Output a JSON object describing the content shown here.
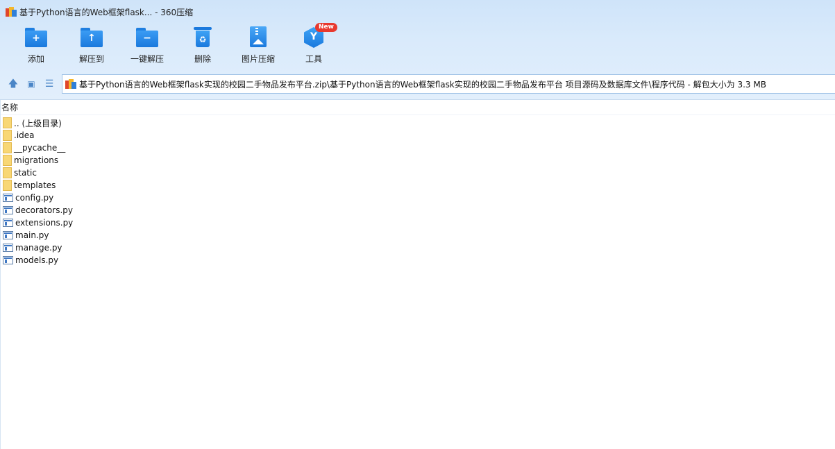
{
  "window": {
    "title": "基于Python语言的Web框架flask... - 360压缩"
  },
  "toolbar": {
    "items": [
      {
        "label": "添加",
        "icon": "add-folder-icon"
      },
      {
        "label": "解压到",
        "icon": "extract-to-icon"
      },
      {
        "label": "一键解压",
        "icon": "one-click-extract-icon"
      },
      {
        "label": "删除",
        "icon": "delete-icon"
      },
      {
        "label": "图片压缩",
        "icon": "image-compress-icon"
      },
      {
        "label": "工具",
        "icon": "tools-icon"
      }
    ],
    "new_badge": "New"
  },
  "navbar": {
    "path": "基于Python语言的Web框架flask实现的校园二手物品发布平台.zip\\基于Python语言的Web框架flask实现的校园二手物品发布平台 项目源码及数据库文件\\程序代码 - 解包大小为 3.3 MB"
  },
  "list": {
    "column_name": "名称",
    "items": [
      {
        "name": ".. (上级目录)",
        "type": "folder"
      },
      {
        "name": ".idea",
        "type": "folder"
      },
      {
        "name": "__pycache__",
        "type": "folder"
      },
      {
        "name": "migrations",
        "type": "folder"
      },
      {
        "name": "static",
        "type": "folder"
      },
      {
        "name": "templates",
        "type": "folder"
      },
      {
        "name": "config.py",
        "type": "file"
      },
      {
        "name": "decorators.py",
        "type": "file"
      },
      {
        "name": "extensions.py",
        "type": "file"
      },
      {
        "name": "main.py",
        "type": "file"
      },
      {
        "name": "manage.py",
        "type": "file"
      },
      {
        "name": "models.py",
        "type": "file"
      }
    ]
  },
  "colors": {
    "accent": "#1a79dd",
    "toolbar_bg": "#d9eafb",
    "badge": "#e8392f"
  }
}
